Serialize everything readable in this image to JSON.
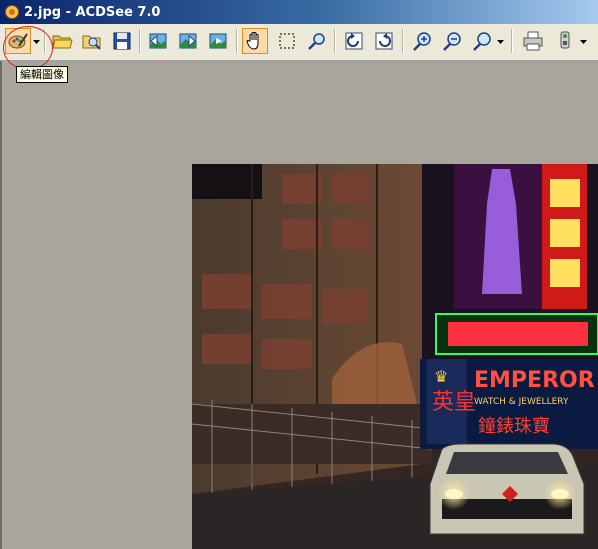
{
  "window": {
    "title": "2.jpg - ACDSee 7.0"
  },
  "toolbar": {
    "tooltip": "編輯圖像",
    "buttons": [
      {
        "name": "edit-image-icon"
      },
      {
        "name": "open-folder-icon"
      },
      {
        "name": "browse-icon"
      },
      {
        "name": "save-icon"
      },
      {
        "name": "previous-image-icon"
      },
      {
        "name": "next-image-icon"
      },
      {
        "name": "auto-advance-icon"
      },
      {
        "name": "hand-tool-icon"
      },
      {
        "name": "select-tool-icon"
      },
      {
        "name": "zoom-tool-icon"
      },
      {
        "name": "rotate-left-icon"
      },
      {
        "name": "rotate-right-icon"
      },
      {
        "name": "zoom-in-icon"
      },
      {
        "name": "zoom-out-icon"
      },
      {
        "name": "zoom-menu-icon"
      },
      {
        "name": "print-icon"
      },
      {
        "name": "acquire-icon"
      }
    ]
  },
  "image": {
    "sign_text": "EMPEROR",
    "sign_subtext": "WATCH & JEWELLERY",
    "chinese_sign": "英皇",
    "chinese_sign2": "鐘錶珠寶"
  },
  "colors": {
    "titlebar_start": "#0a246a",
    "titlebar_end": "#a6caf0",
    "toolbar_bg": "#ece9d8",
    "workspace_bg": "#a8a69b",
    "tooltip_bg": "#ffffe1",
    "highlight_circle": "#e02020"
  }
}
